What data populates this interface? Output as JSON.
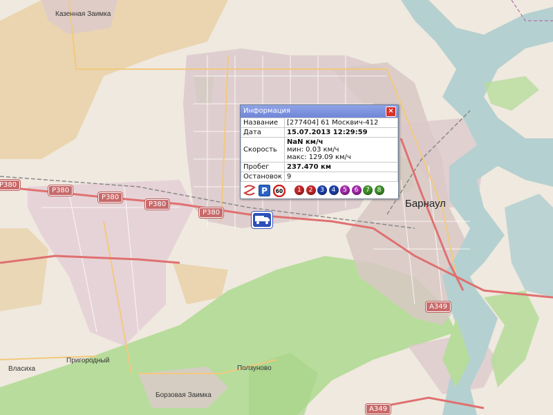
{
  "map": {
    "places": [
      {
        "name": "Казенная Заимка"
      },
      {
        "name": "Барнаул"
      },
      {
        "name": "Власиха"
      },
      {
        "name": "Пригородный"
      },
      {
        "name": "Борзовая Заимка"
      },
      {
        "name": "Ползуново"
      }
    ],
    "road_shields": [
      "P380",
      "P380",
      "P380",
      "P380",
      "A349",
      "A349"
    ],
    "colors": {
      "river": "#b5d0d0",
      "forest": "#b8dc9c",
      "residential": "#dcc9cc",
      "industrial": "#e4cfd6",
      "farmland": "#e8cfa4",
      "major_road": "#e07070"
    }
  },
  "popup": {
    "title": "Информация",
    "close_icon": "close-icon",
    "rows": {
      "name_label": "Название",
      "name_value": "[277404] 61 Москвич-412",
      "date_label": "Дата",
      "date_value": "15.07.2013 12:29:59",
      "speed_label": "Скорость",
      "speed_value": "NaN км/ч",
      "speed_min": "мин: 0.03 км/ч",
      "speed_max": "макс: 129.09 км/ч",
      "mileage_label": "Пробег",
      "mileage_value": "237.470 км",
      "stops_label": "Остановок",
      "stops_value": "9"
    },
    "tool_icons": [
      "track-icon",
      "parking-icon",
      "speed-limit-icon"
    ],
    "speed_limit_text": "60",
    "parking_text": "P",
    "stop_numbers": [
      {
        "n": "1",
        "color": "#c0282a"
      },
      {
        "n": "2",
        "color": "#c0282a"
      },
      {
        "n": "3",
        "color": "#1d3fa8"
      },
      {
        "n": "4",
        "color": "#1d3fa8"
      },
      {
        "n": "5",
        "color": "#a22aa8"
      },
      {
        "n": "6",
        "color": "#a22aa8"
      },
      {
        "n": "7",
        "color": "#3f8f2a"
      },
      {
        "n": "8",
        "color": "#3f8f2a"
      }
    ]
  },
  "vehicle": {
    "icon": "truck-icon"
  }
}
